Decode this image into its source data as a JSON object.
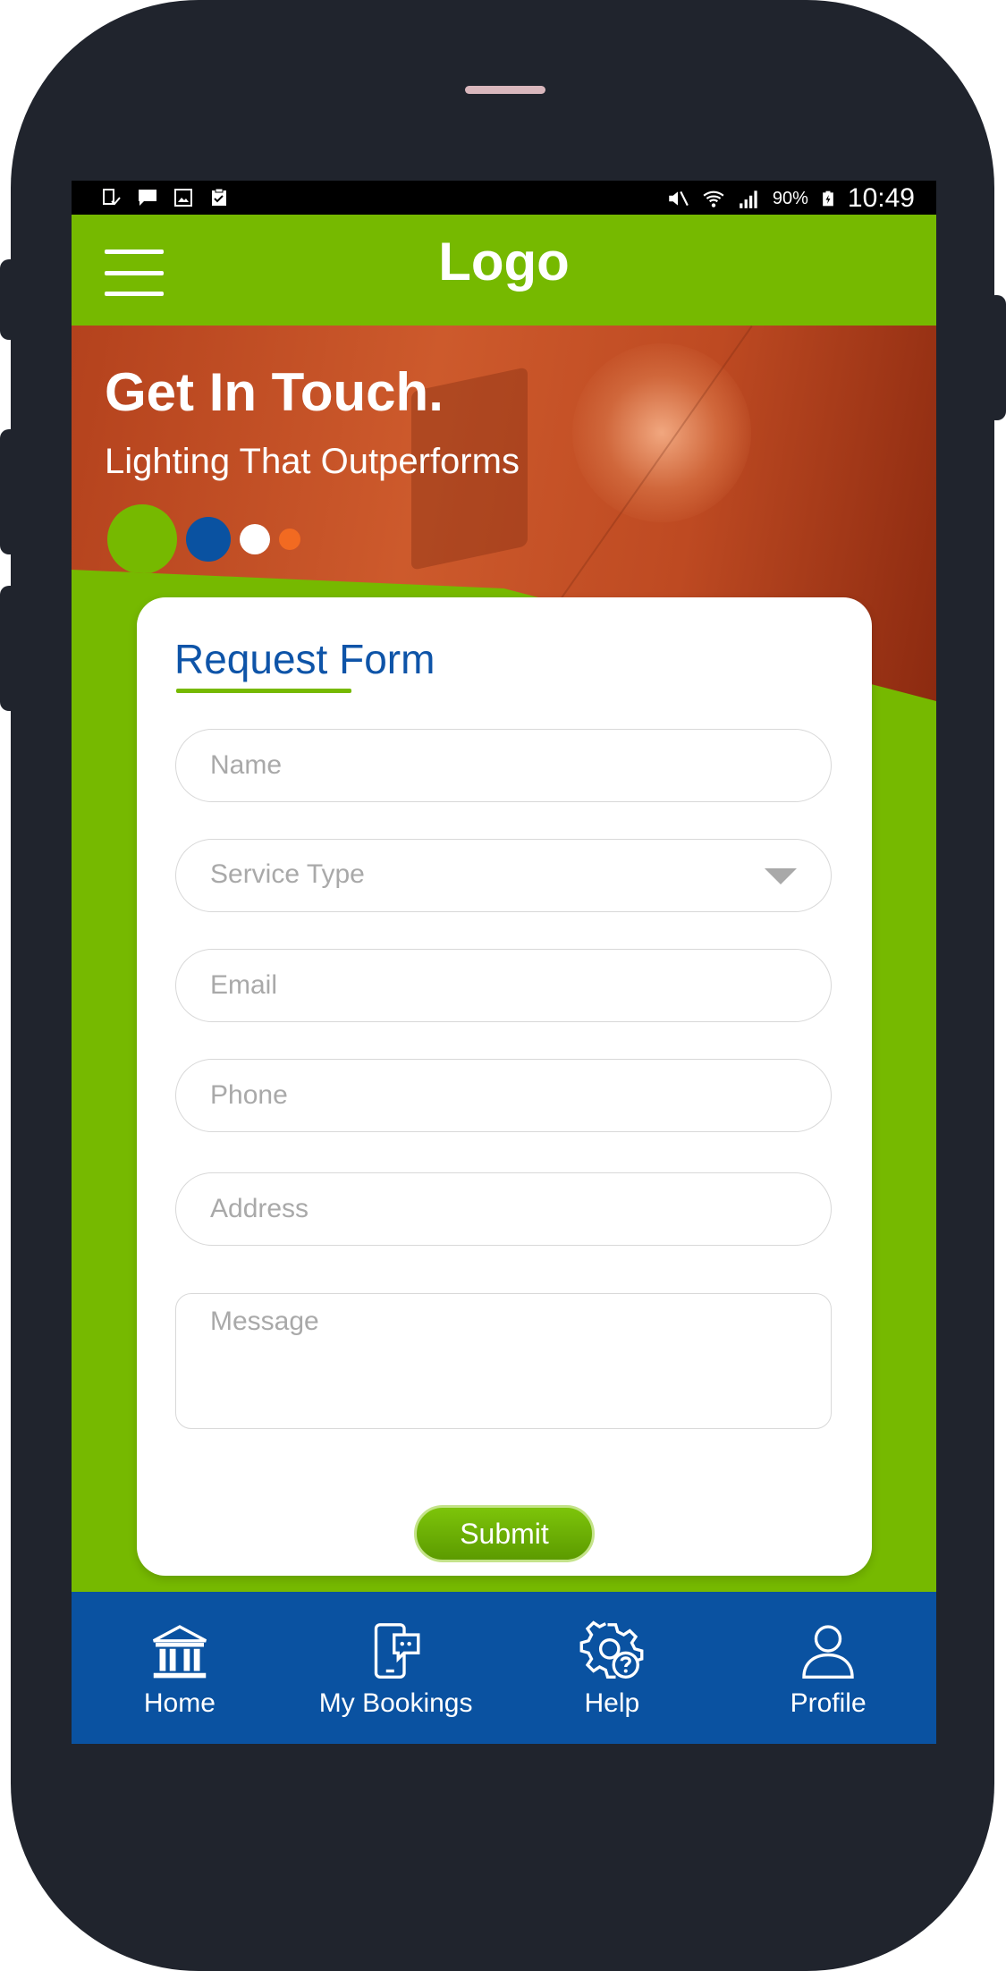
{
  "status_bar": {
    "left_icons": [
      "device-check-icon",
      "message-icon",
      "image-icon",
      "clipboard-check-icon"
    ],
    "right_icons": [
      "mute-icon",
      "wifi-icon",
      "signal-icon"
    ],
    "battery": "90%",
    "time": "10:49"
  },
  "header": {
    "logo": "Logo",
    "menu_icon": "hamburger-icon"
  },
  "hero": {
    "title": "Get In Touch.",
    "subtitle": "Lighting That Outperforms",
    "dots": [
      {
        "color": "#76b900",
        "size": "large"
      },
      {
        "color": "#0a52a1",
        "size": "medium"
      },
      {
        "color": "#ffffff",
        "size": "small"
      },
      {
        "color": "#f26a21",
        "size": "tiny"
      }
    ]
  },
  "form": {
    "title": "Request Form",
    "fields": {
      "name": {
        "placeholder": "Name",
        "value": ""
      },
      "service_type": {
        "placeholder": "Service Type",
        "value": ""
      },
      "email": {
        "placeholder": "Email",
        "value": ""
      },
      "phone": {
        "placeholder": "Phone",
        "value": ""
      },
      "address": {
        "placeholder": "Address",
        "value": ""
      },
      "message": {
        "placeholder": "Message",
        "value": ""
      }
    },
    "submit_label": "Submit"
  },
  "bottom_nav": [
    {
      "label": "Home",
      "icon": "bank-icon"
    },
    {
      "label": "My Bookings",
      "icon": "mobile-chat-icon"
    },
    {
      "label": "Help",
      "icon": "gear-help-icon"
    },
    {
      "label": "Profile",
      "icon": "user-icon"
    }
  ],
  "colors": {
    "primary_green": "#76b900",
    "primary_blue": "#0a52a1",
    "title_blue": "#0e54a8",
    "frame": "#20242d"
  }
}
